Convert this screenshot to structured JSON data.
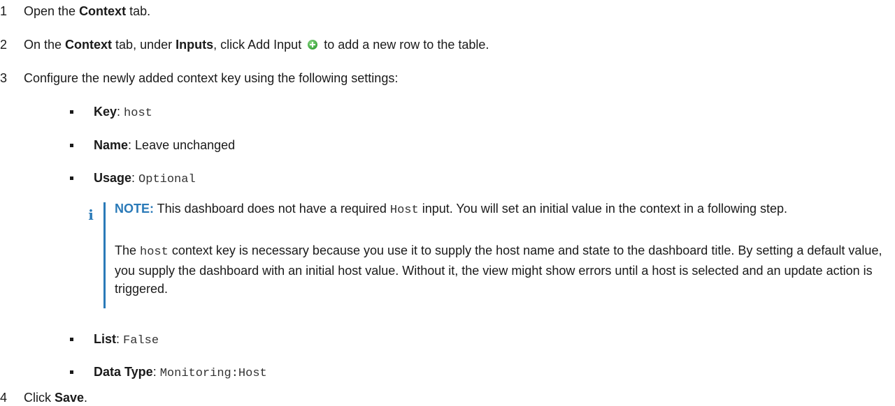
{
  "steps": [
    {
      "num": "1",
      "pre": "Open the ",
      "bold": "Context",
      "post": " tab."
    },
    {
      "num": "2",
      "pre": "On the ",
      "bold1": "Context",
      "mid1": " tab, under ",
      "bold2": "Inputs",
      "mid2": ", click Add Input",
      "post": " to add a new row to the table."
    },
    {
      "num": "3",
      "text": "Configure the newly added context key using the following settings:"
    },
    {
      "num": "4",
      "pre": "Click ",
      "bold": "Save",
      "post": "."
    }
  ],
  "settings": [
    {
      "label": "Key",
      "sep": ": ",
      "value": "host",
      "mono": true
    },
    {
      "label": "Name",
      "sep": ": ",
      "value": "Leave unchanged",
      "mono": false
    },
    {
      "label": "Usage",
      "sep": ": ",
      "value": "Optional",
      "mono": true
    },
    {
      "label": "List",
      "sep": ": ",
      "value": "False",
      "mono": true
    },
    {
      "label": "Data Type",
      "sep": ": ",
      "value": "Monitoring:Host",
      "mono": true
    }
  ],
  "note": {
    "icon": "i",
    "label": "NOTE:",
    "p1_a": " This dashboard does not have a required ",
    "p1_code": "Host",
    "p1_b": " input. You will set an initial value in the context in a following step.",
    "p2_a": "The ",
    "p2_code": "host",
    "p2_b": " context key is necessary because you use it to supply the host name and state to the dashboard title. By setting a default value, you supply the dashboard with an initial host value. Without it, the view might show errors until a host is selected and an update action is triggered."
  },
  "colors": {
    "note_accent": "#2a7ab8",
    "add_icon": "#3aa53a"
  }
}
